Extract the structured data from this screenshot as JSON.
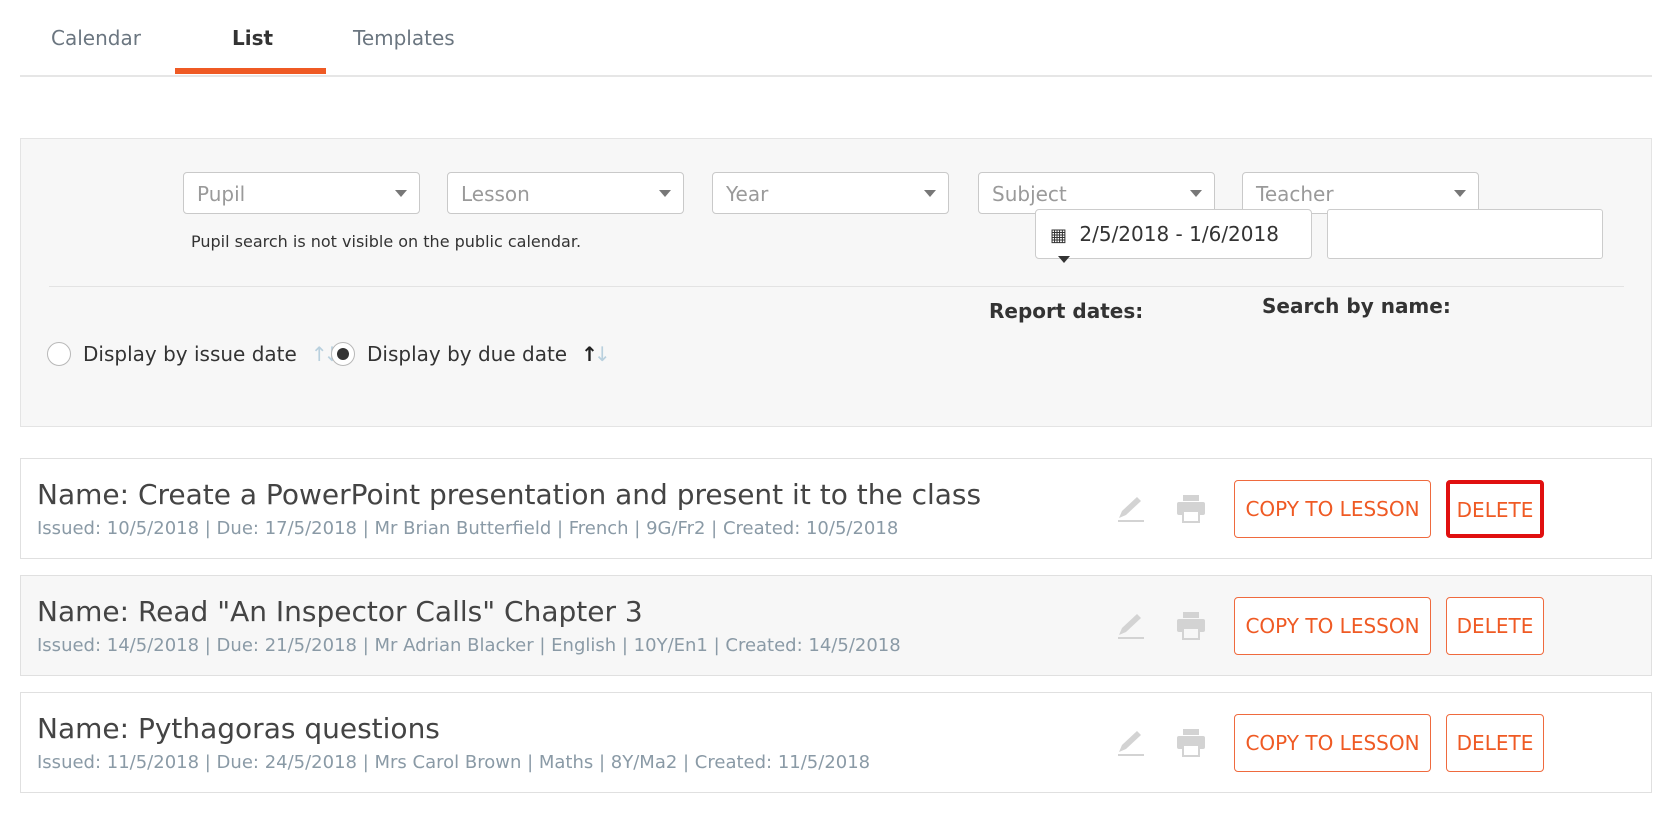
{
  "tabs": [
    {
      "label": "Calendar"
    },
    {
      "label": "List"
    },
    {
      "label": "Templates"
    }
  ],
  "filters": {
    "pupil": "Pupil",
    "lesson": "Lesson",
    "year": "Year",
    "subject": "Subject",
    "teacher": "Teacher",
    "hint": "Pupil search is not visible on the public calendar."
  },
  "display": {
    "issue_label": "Display by issue date",
    "due_label": "Display by due date"
  },
  "report": {
    "label": "Report dates:",
    "range": "2/5/2018 - 1/6/2018"
  },
  "search": {
    "label": "Search by name:",
    "value": ""
  },
  "buttons": {
    "copy": "COPY TO LESSON",
    "delete": "DELETE"
  },
  "tasks": [
    {
      "name": "Name: Create a PowerPoint presentation and present it to the class",
      "meta": "Issued: 10/5/2018 | Due: 17/5/2018 | Mr Brian Butterfield | French | 9G/Fr2 | Created: 10/5/2018"
    },
    {
      "name": "Name: Read \"An Inspector Calls\" Chapter 3",
      "meta": "Issued: 14/5/2018 | Due: 21/5/2018 | Mr Adrian Blacker | English | 10Y/En1 | Created: 14/5/2018"
    },
    {
      "name": "Name: Pythagoras questions",
      "meta": "Issued: 11/5/2018 | Due: 24/5/2018 | Mrs Carol Brown | Maths | 8Y/Ma2 | Created: 11/5/2018"
    }
  ]
}
